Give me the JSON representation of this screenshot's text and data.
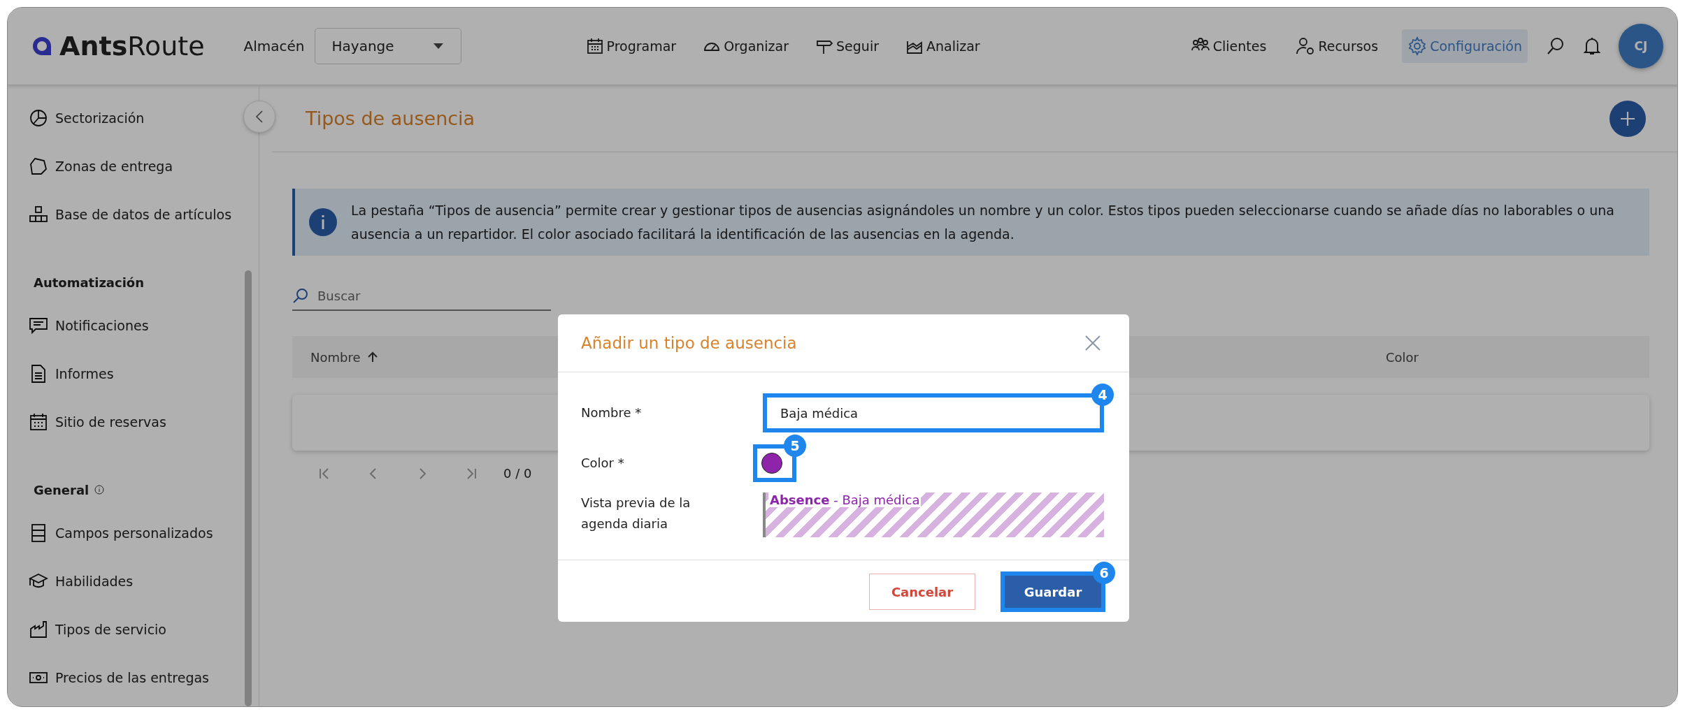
{
  "topbar": {
    "logo_bold": "Ants",
    "logo_light": "Route",
    "warehouse_label": "Almacén",
    "warehouse_value": "Hayange",
    "nav": [
      {
        "label": "Programar"
      },
      {
        "label": "Organizar"
      },
      {
        "label": "Seguir"
      },
      {
        "label": "Analizar"
      }
    ],
    "right_nav": [
      {
        "label": "Clientes",
        "selected": false
      },
      {
        "label": "Recursos",
        "selected": false
      },
      {
        "label": "Configuración",
        "selected": true
      }
    ],
    "avatar": "CJ"
  },
  "sidebar": {
    "sections": [
      {
        "items": [
          {
            "label": "Sectorización"
          },
          {
            "label": "Zonas de entrega"
          },
          {
            "label": "Base de datos de artículos"
          }
        ]
      },
      {
        "title": "Automatización",
        "items": [
          {
            "label": "Notificaciones"
          },
          {
            "label": "Informes"
          },
          {
            "label": "Sitio de reservas"
          }
        ]
      },
      {
        "title": "General",
        "info": true,
        "items": [
          {
            "label": "Campos personalizados"
          },
          {
            "label": "Habilidades"
          },
          {
            "label": "Tipos de servicio"
          },
          {
            "label": "Precios de las entregas"
          }
        ]
      }
    ]
  },
  "page": {
    "title": "Tipos de ausencia",
    "info": "La pestaña “Tipos de ausencia” permite crear y gestionar tipos de ausencias asignándoles un nombre y un color. Estos tipos pueden seleccionarse cuando se añade días no laborables o una ausencia a un repartidor. El color asociado facilitará la identificación de las ausencias en la agenda.",
    "search": {
      "placeholder": "Buscar"
    },
    "table": {
      "columns": [
        {
          "label": "Nombre",
          "sorted": true
        },
        {
          "label": "Color",
          "sorted": false
        }
      ]
    },
    "pagination": "0 / 0"
  },
  "modal": {
    "title": "Añadir un tipo de ausencia",
    "name_field": {
      "label": "Nombre *",
      "value": "Baja médica",
      "callout": "4"
    },
    "color_field": {
      "label": "Color *",
      "color": "#8e24aa",
      "callout": "5"
    },
    "preview": {
      "label": "Vista previa de la agenda diaria",
      "type": "Absence",
      "separator": " - ",
      "name": "Baja médica"
    },
    "cancel": "Cancelar",
    "save": {
      "label": "Guardar",
      "callout": "6"
    }
  }
}
